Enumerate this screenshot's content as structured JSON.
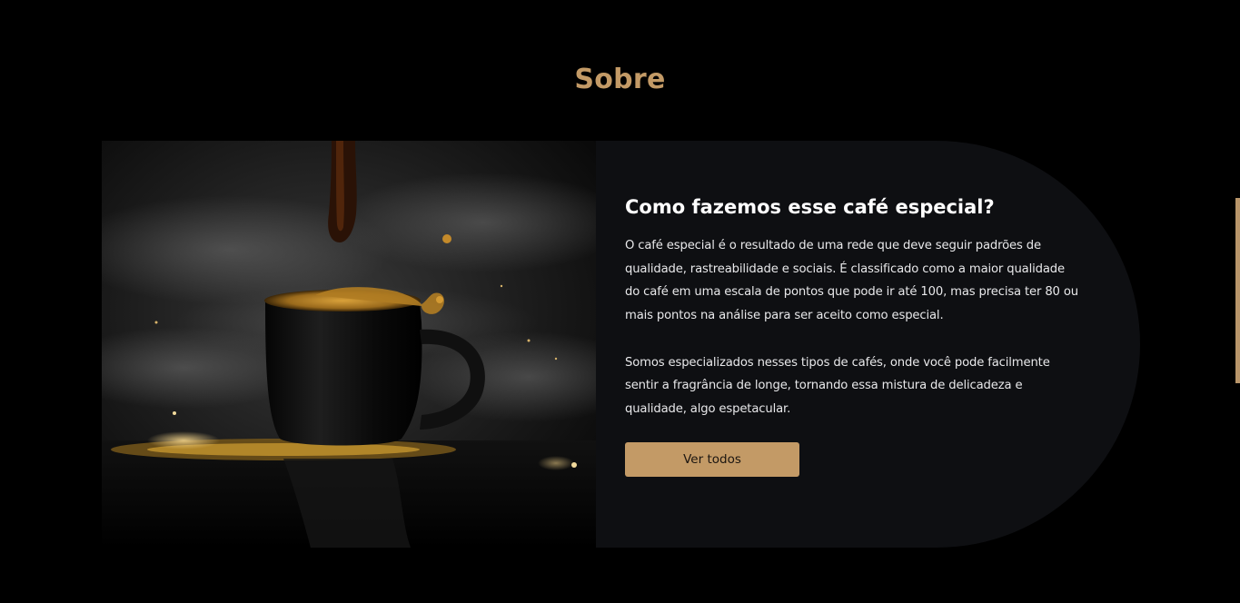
{
  "about": {
    "section_title": "Sobre",
    "image_alt": "Café sendo derramado em uma xícara preta",
    "heading": "Como fazemos esse café especial?",
    "paragraph_1": "O café especial é o resultado de uma rede que deve seguir padrões de qualidade, rastreabilidade e sociais. É classificado como a maior qualidade do café em uma escala de pontos que pode ir até 100, mas precisa ter 80 ou mais pontos na análise para ser aceito como especial.",
    "paragraph_2": "Somos especializados nesses tipos de cafés, onde você pode facilmente sentir a fragrância de longe, tornando essa mistura de delicadeza e qualidade, algo espetacular.",
    "button_label": "Ver todos"
  },
  "colors": {
    "background": "#000000",
    "accent": "#c39a66",
    "panel": "#0e0f12",
    "text": "#ffffff"
  }
}
